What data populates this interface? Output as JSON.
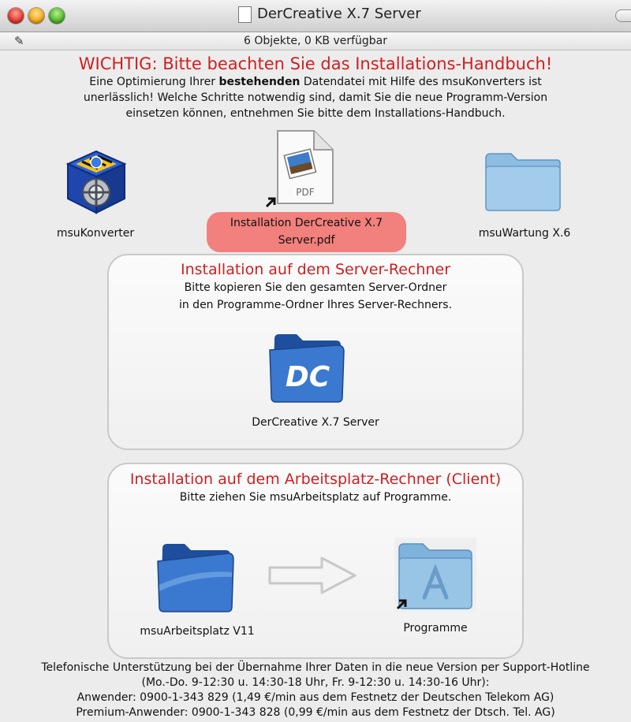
{
  "window": {
    "title": "DerCreative X.7 Server",
    "status": "6 Objekte, 0 KB verfügbar"
  },
  "notice": {
    "title": "WICHTIG: Bitte beachten Sie das Installations-Handbuch!",
    "line1_prefix": "Eine Optimierung Ihrer ",
    "line1_bold": "bestehenden",
    "line1_suffix": " Datendatei mit Hilfe des msuKonverters ist",
    "line2": "unerlässlich! Welche Schritte notwendig sind, damit Sie die neue Programm-Version",
    "line3": "einsetzen können, entnehmen Sie bitte dem Installations-Handbuch."
  },
  "icons": {
    "konverter": "msuKonverter",
    "pdf_line1": "Installation DerCreative X.7",
    "pdf_line2": "Server.pdf",
    "pdf_badge": "PDF",
    "wartung": "msuWartung X.6"
  },
  "server_panel": {
    "title": "Installation auf dem Server-Rechner",
    "line1": "Bitte kopieren Sie den gesamten Server-Ordner",
    "line2": "in den Programme-Ordner Ihres Server-Rechners.",
    "folder_badge": "DC",
    "folder_label": "DerCreative X.7 Server"
  },
  "client_panel": {
    "title": "Installation auf dem Arbeitsplatz-Rechner (Client)",
    "line1": "Bitte ziehen Sie msuArbeitsplatz auf Programme.",
    "source_label": "msuArbeitsplatz V11",
    "target_label": "Programme"
  },
  "footer": {
    "line1": "Telefonische Unterstützung bei der Übernahme Ihrer Daten in die neue Version per Support-Hotline",
    "line2": "(Mo.-Do. 9-12:30 u. 14:30-18 Uhr, Fr. 9-12:30 u. 14:30-16 Uhr):",
    "line3": "Anwender: 0900-1-343 829 (1,49 €/min aus dem Festnetz der Deutschen Telekom AG)",
    "line4": "Premium-Anwender: 0900-1-343 828 (0,99 €/min aus dem Festnetz der Dtsch. Tel. AG)"
  },
  "colors": {
    "accent_red": "#cf1f21",
    "pdf_label_bg": "#f2807d",
    "folder_blue": "#7fb3dc"
  }
}
